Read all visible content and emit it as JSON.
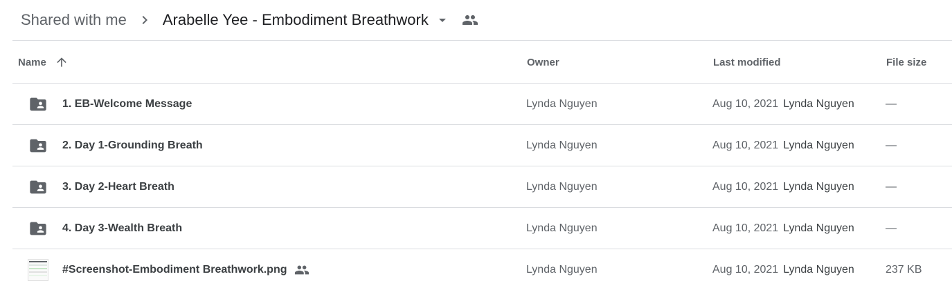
{
  "breadcrumb": {
    "root": "Shared with me",
    "current": "Arabelle Yee - Embodiment Breathwork"
  },
  "columns": {
    "name": "Name",
    "owner": "Owner",
    "modified": "Last modified",
    "size": "File size"
  },
  "icons": {
    "separator": "chevron-right-icon",
    "dropdown": "caret-down-icon",
    "shared": "people-icon",
    "sort": "arrow-up-icon",
    "folder": "shared-folder-icon",
    "image": "image-thumbnail"
  },
  "files": [
    {
      "name": "1. EB-Welcome Message",
      "type": "folder",
      "owner": "Lynda Nguyen",
      "modified_date": "Aug 10, 2021",
      "modified_by": "Lynda Nguyen",
      "size": "—"
    },
    {
      "name": "2. Day 1-Grounding Breath",
      "type": "folder",
      "owner": "Lynda Nguyen",
      "modified_date": "Aug 10, 2021",
      "modified_by": "Lynda Nguyen",
      "size": "—"
    },
    {
      "name": "3. Day 2-Heart Breath",
      "type": "folder",
      "owner": "Lynda Nguyen",
      "modified_date": "Aug 10, 2021",
      "modified_by": "Lynda Nguyen",
      "size": "—"
    },
    {
      "name": "4. Day 3-Wealth Breath",
      "type": "folder",
      "owner": "Lynda Nguyen",
      "modified_date": "Aug 10, 2021",
      "modified_by": "Lynda Nguyen",
      "size": "—"
    },
    {
      "name": "#Screenshot-Embodiment Breathwork.png",
      "type": "image",
      "shared": true,
      "owner": "Lynda Nguyen",
      "modified_date": "Aug 10, 2021",
      "modified_by": "Lynda Nguyen",
      "size": "237 KB"
    }
  ],
  "colors": {
    "text_primary": "#3c4043",
    "text_secondary": "#5f6368",
    "divider": "#dadce0",
    "icon": "#5f6368"
  }
}
